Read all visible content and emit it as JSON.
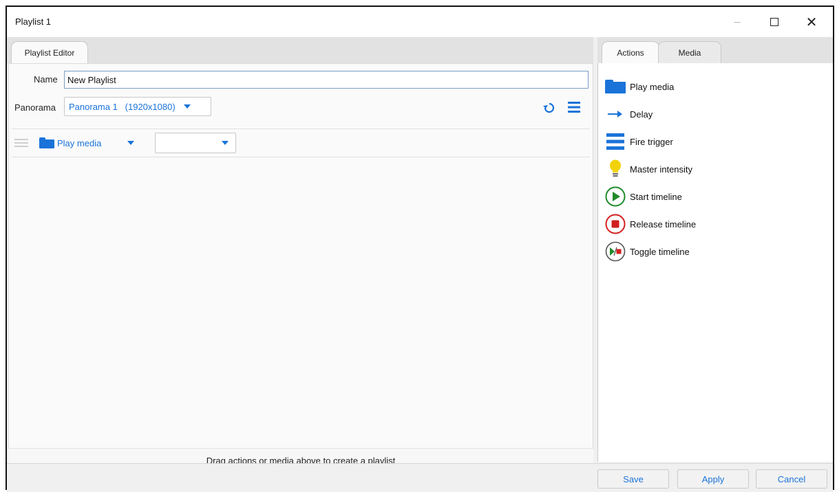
{
  "window": {
    "title": "Playlist 1"
  },
  "left_tab": "Playlist Editor",
  "right_tabs": [
    "Actions",
    "Media"
  ],
  "name_label": "Name",
  "name_value": "New Playlist",
  "panorama_label": "Panorama",
  "panorama_value": "Panorama 1   (1920x1080)",
  "row": {
    "action_label": "Play media",
    "second_combo_value": ""
  },
  "hint": "Drag actions or media above to create a playlist",
  "actions": [
    {
      "label": "Play media",
      "icon": "folder-icon"
    },
    {
      "label": "Delay",
      "icon": "arrow-right-icon"
    },
    {
      "label": "Fire trigger",
      "icon": "trigger-icon"
    },
    {
      "label": "Master intensity",
      "icon": "lightbulb-icon"
    },
    {
      "label": "Start timeline",
      "icon": "play-circle-icon"
    },
    {
      "label": "Release timeline",
      "icon": "stop-circle-icon"
    },
    {
      "label": "Toggle timeline",
      "icon": "toggle-circle-icon"
    }
  ],
  "buttons": {
    "save": "Save",
    "apply": "Apply",
    "cancel": "Cancel"
  },
  "colors": {
    "accent": "#1a73d9",
    "green": "#1f8a2a",
    "red": "#d21f1f",
    "bulb": "#f2d20a"
  }
}
